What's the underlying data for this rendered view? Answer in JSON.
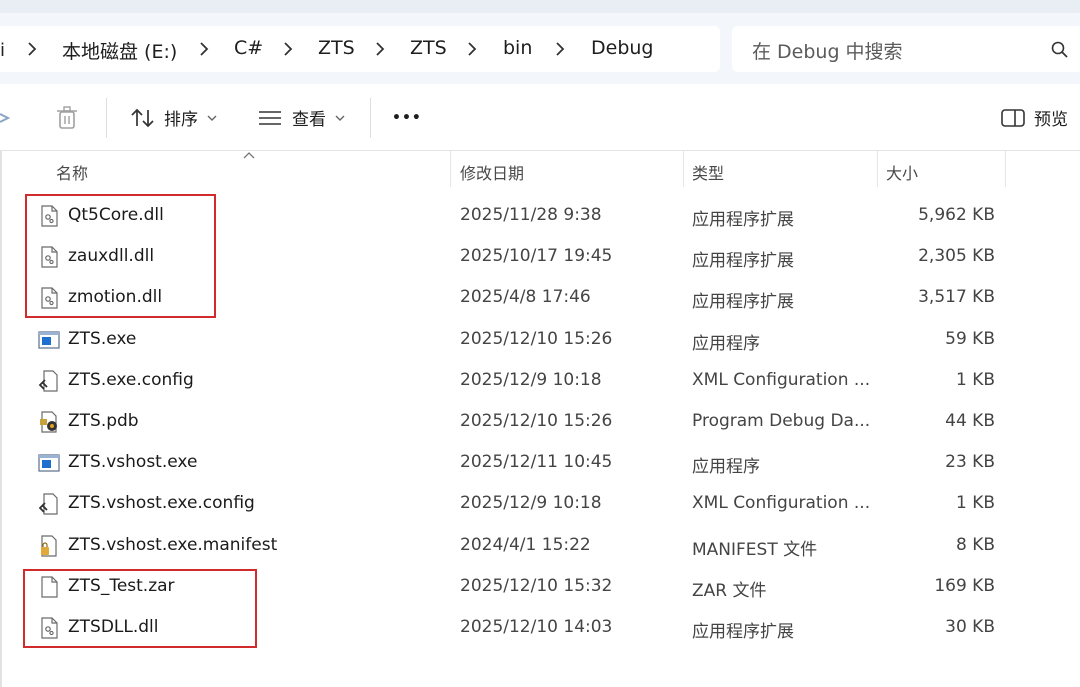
{
  "address": {
    "lead": "i",
    "crumbs": [
      "本地磁盘 (E:)",
      "C#",
      "ZTS",
      "ZTS",
      "bin",
      "Debug"
    ]
  },
  "search": {
    "placeholder": "在 Debug 中搜索",
    "icon": "search-icon"
  },
  "toolbar": {
    "sort_label": "排序",
    "view_label": "查看",
    "more_label": "•••",
    "preview_label": "预览"
  },
  "columns": {
    "name": "名称",
    "date": "修改日期",
    "type": "类型",
    "size": "大小"
  },
  "files": [
    {
      "name": "Qt5Core.dll",
      "date": "2025/11/28 9:38",
      "type": "应用程序扩展",
      "size": "5,962 KB",
      "icon": "dll-file-icon"
    },
    {
      "name": "zauxdll.dll",
      "date": "2025/10/17 19:45",
      "type": "应用程序扩展",
      "size": "2,305 KB",
      "icon": "dll-file-icon"
    },
    {
      "name": "zmotion.dll",
      "date": "2025/4/8 17:46",
      "type": "应用程序扩展",
      "size": "3,517 KB",
      "icon": "dll-file-icon"
    },
    {
      "name": "ZTS.exe",
      "date": "2025/12/10 15:26",
      "type": "应用程序",
      "size": "59 KB",
      "icon": "exe-file-icon"
    },
    {
      "name": "ZTS.exe.config",
      "date": "2025/12/9 10:18",
      "type": "XML Configuration ...",
      "size": "1 KB",
      "icon": "config-file-icon"
    },
    {
      "name": "ZTS.pdb",
      "date": "2025/12/10 15:26",
      "type": "Program Debug Da...",
      "size": "44 KB",
      "icon": "pdb-file-icon"
    },
    {
      "name": "ZTS.vshost.exe",
      "date": "2025/12/11 10:45",
      "type": "应用程序",
      "size": "23 KB",
      "icon": "exe-file-icon"
    },
    {
      "name": "ZTS.vshost.exe.config",
      "date": "2025/12/9 10:18",
      "type": "XML Configuration ...",
      "size": "1 KB",
      "icon": "config-file-icon"
    },
    {
      "name": "ZTS.vshost.exe.manifest",
      "date": "2024/4/1 15:22",
      "type": "MANIFEST 文件",
      "size": "8 KB",
      "icon": "manifest-file-icon"
    },
    {
      "name": "ZTS_Test.zar",
      "date": "2025/12/10 15:32",
      "type": "ZAR 文件",
      "size": "169 KB",
      "icon": "generic-file-icon"
    },
    {
      "name": "ZTSDLL.dll",
      "date": "2025/12/10 14:03",
      "type": "应用程序扩展",
      "size": "30 KB",
      "icon": "dll-file-icon"
    }
  ],
  "colors": {
    "highlight": "#d22b2b",
    "exe_blue": "#1f6fd1",
    "toolbar_bg": "#f3f6fb"
  }
}
